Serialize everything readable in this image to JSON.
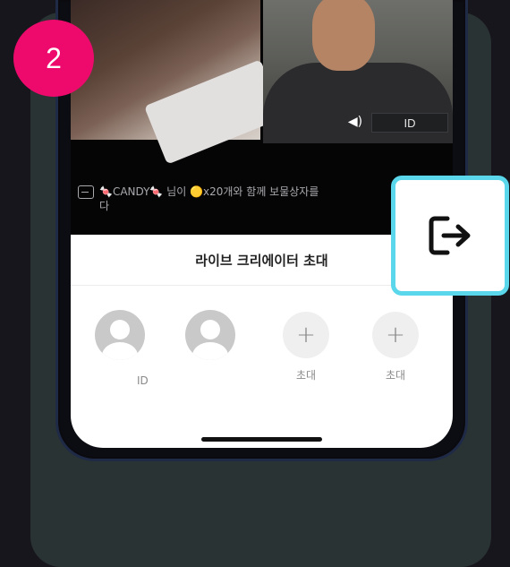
{
  "step": {
    "number": "2"
  },
  "video": {
    "right_label": "ID"
  },
  "chat": {
    "message": "🍬CANDY🍬 님이 🟡x20개와 함께 보물상자를",
    "message_cont": "다"
  },
  "sheet": {
    "title": "라이브 크리에이터 초대",
    "slots": [
      {
        "type": "avatar",
        "label": ""
      },
      {
        "type": "avatar",
        "label": "ID"
      },
      {
        "type": "add",
        "label": "초대"
      },
      {
        "type": "add",
        "label": "초대"
      }
    ]
  },
  "icons": {
    "exit": "exit-icon",
    "speaker": "speaker-icon",
    "chat": "message-icon",
    "add": "plus-icon"
  },
  "colors": {
    "badge": "#ee0a6d",
    "highlight": "#5ad7ea",
    "panel": "#2a3333"
  }
}
